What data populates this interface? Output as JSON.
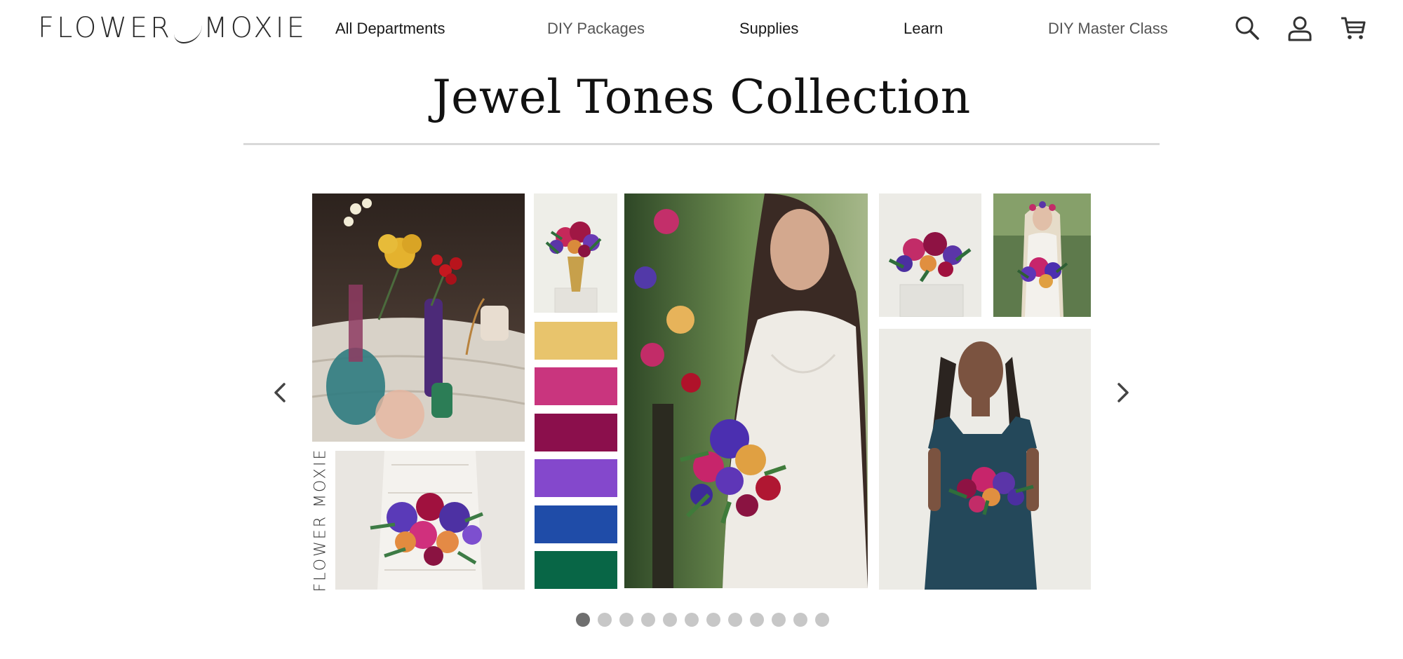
{
  "header": {
    "logo_text_left": "FLOWER",
    "logo_text_right": "MOXIE",
    "nav": [
      {
        "label": "All Departments"
      },
      {
        "label": "DIY Packages"
      },
      {
        "label": "Supplies"
      },
      {
        "label": "Learn"
      },
      {
        "label": "DIY Master Class"
      }
    ],
    "icons": [
      "search-icon",
      "account-icon",
      "cart-icon"
    ]
  },
  "page": {
    "title": "Jewel Tones Collection"
  },
  "carousel": {
    "watermark": "FLOWER MOXIE",
    "palette": [
      "#E8C46C",
      "#C9357E",
      "#8B0F4C",
      "#8448CC",
      "#1F4CA8",
      "#086646"
    ],
    "slide_count": 12,
    "active_slide": 1,
    "prev_icon": "chevron-left-icon",
    "next_icon": "chevron-right-icon"
  }
}
